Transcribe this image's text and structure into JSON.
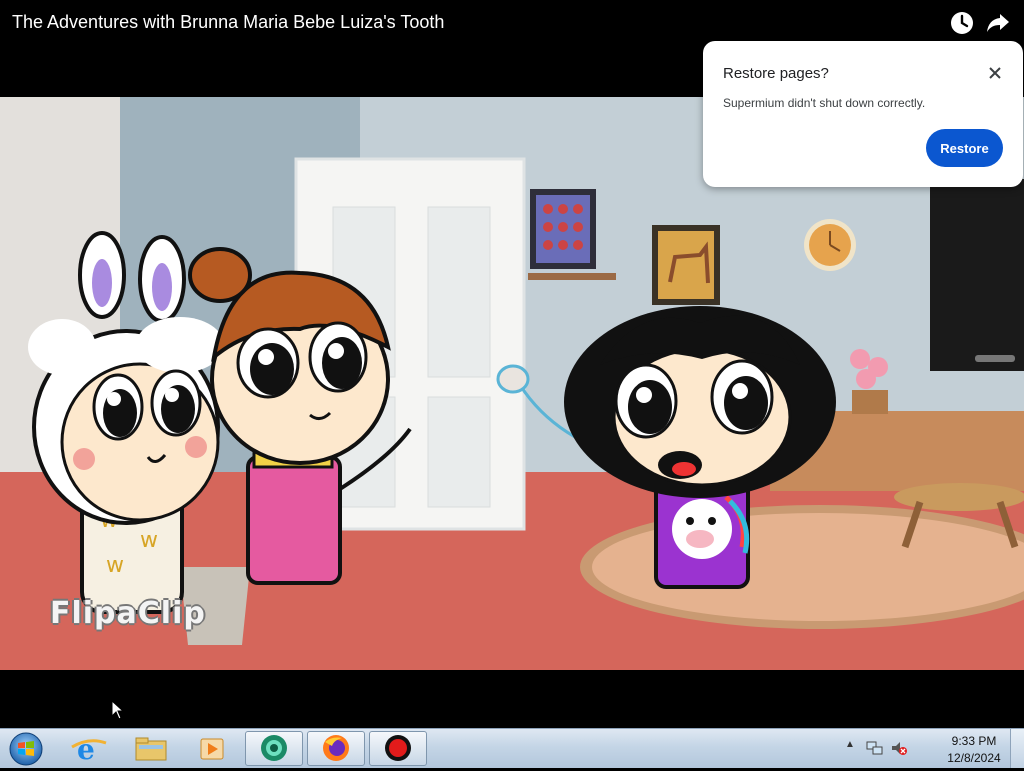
{
  "video": {
    "title": "The Adventures with Brunna Maria Bebe Luiza's Tooth",
    "watermark": "FlipaClip",
    "icons": {
      "watch_later": "clock-icon",
      "share": "share-icon"
    }
  },
  "dialog": {
    "title": "Restore pages?",
    "message": "Supermium didn't shut down correctly.",
    "restore_label": "Restore",
    "close_icon": "close-icon",
    "accent": "#0b57d0"
  },
  "taskbar": {
    "start_icon": "windows-start-icon",
    "apps": [
      {
        "name": "Internet Explorer",
        "icon": "ie-icon"
      },
      {
        "name": "Windows Explorer",
        "icon": "folder-icon"
      },
      {
        "name": "Windows Media Player",
        "icon": "media-player-icon"
      },
      {
        "name": "Supermium",
        "icon": "supermium-icon"
      },
      {
        "name": "Firefox",
        "icon": "firefox-icon"
      },
      {
        "name": "Screen Recorder",
        "icon": "record-icon"
      }
    ],
    "clock": {
      "time": "9:33 PM",
      "date": "12/8/2024"
    }
  }
}
